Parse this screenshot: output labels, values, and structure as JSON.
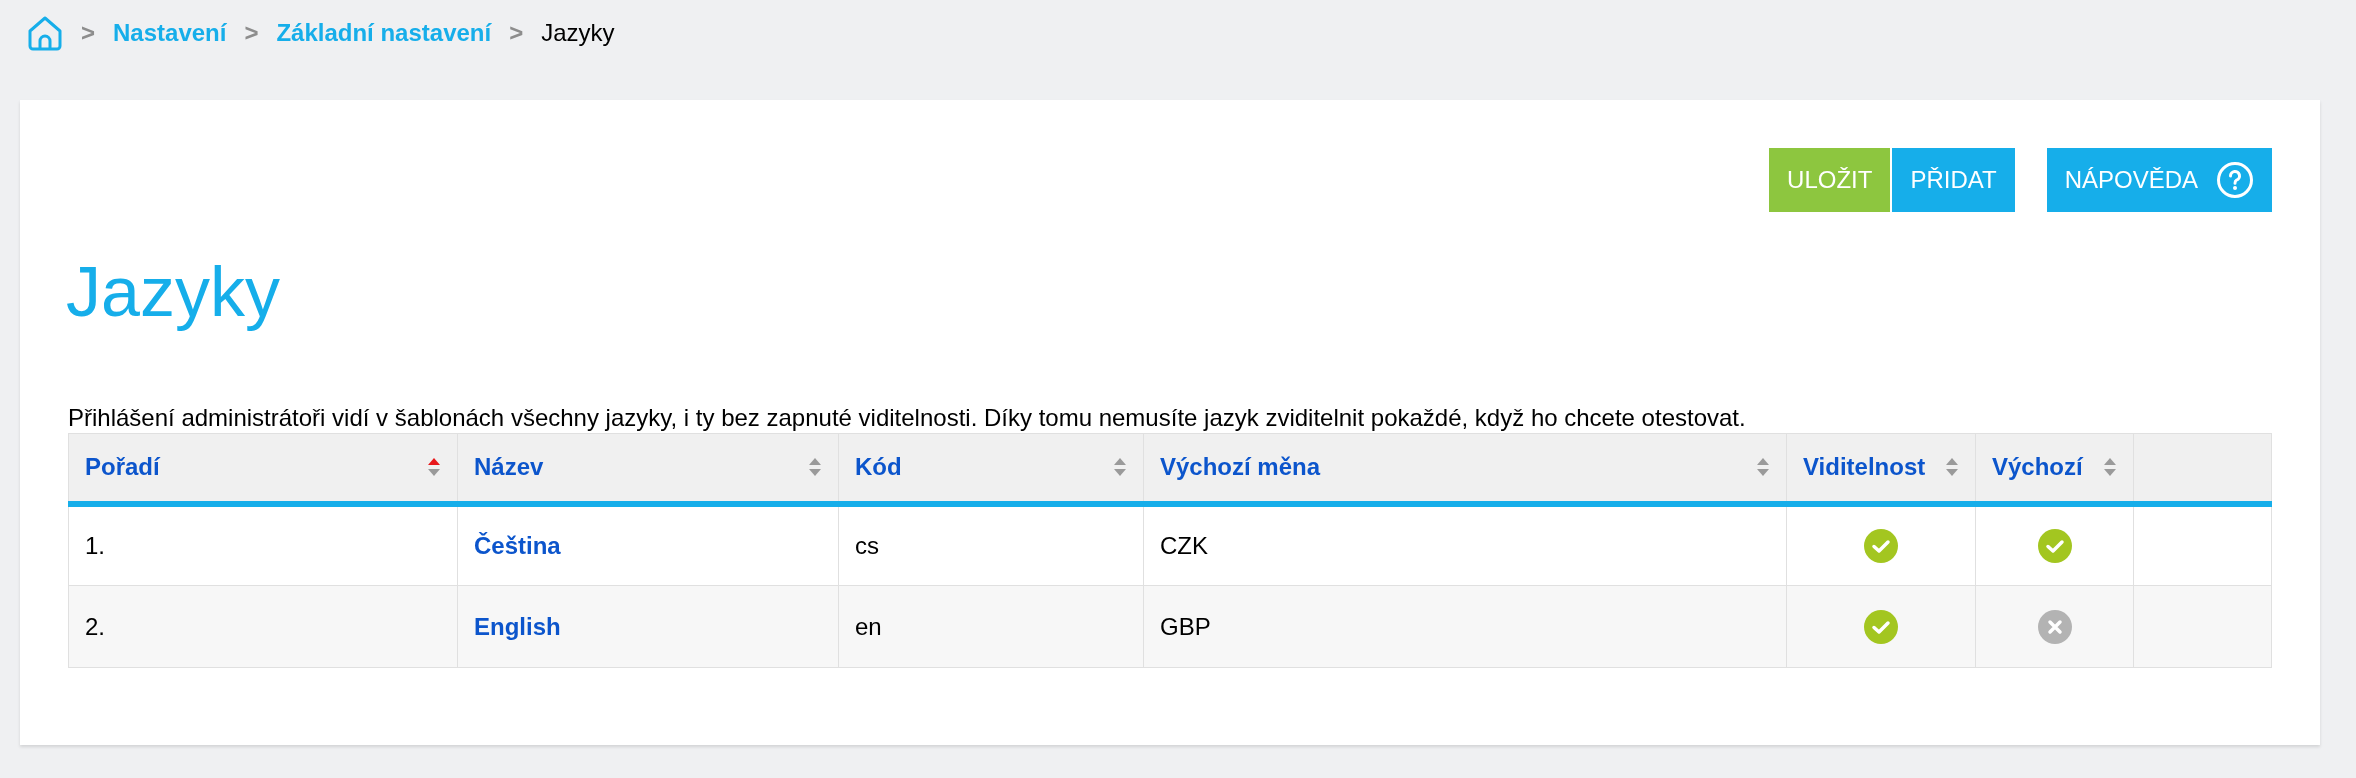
{
  "breadcrumb": {
    "items": [
      {
        "label": "Nastavení",
        "kind": "link"
      },
      {
        "label": "Základní nastavení",
        "kind": "link"
      },
      {
        "label": "Jazyky",
        "kind": "current"
      }
    ],
    "separator": ">"
  },
  "toolbar": {
    "buttons": [
      {
        "label": "ULOŽIT",
        "kind": "save"
      },
      {
        "label": "PŘIDAT",
        "kind": "add"
      },
      {
        "label": "NÁPOVĚDA",
        "kind": "help"
      }
    ]
  },
  "page_title": "Jazyky",
  "notice": "Přihlášení administrátoři vidí v šablonách všechny jazyky, i ty bez zapnuté viditelnosti. Díky tomu nemusíte jazyk zviditelnit pokaždé, když ho chcete otestovat.",
  "table": {
    "columns": [
      {
        "label": "Pořadí",
        "sorted": true
      },
      {
        "label": "Název",
        "sorted": false
      },
      {
        "label": "Kód",
        "sorted": false
      },
      {
        "label": "Výchozí měna",
        "sorted": false
      },
      {
        "label": "Viditelnost",
        "sorted": false
      },
      {
        "label": "Výchozí",
        "sorted": false
      }
    ],
    "rows": [
      {
        "order": "1.",
        "name": "Čeština",
        "code": "cs",
        "currency": "CZK",
        "visible": true,
        "default": true
      },
      {
        "order": "2.",
        "name": "English",
        "code": "en",
        "currency": "GBP",
        "visible": true,
        "default": false
      }
    ]
  }
}
